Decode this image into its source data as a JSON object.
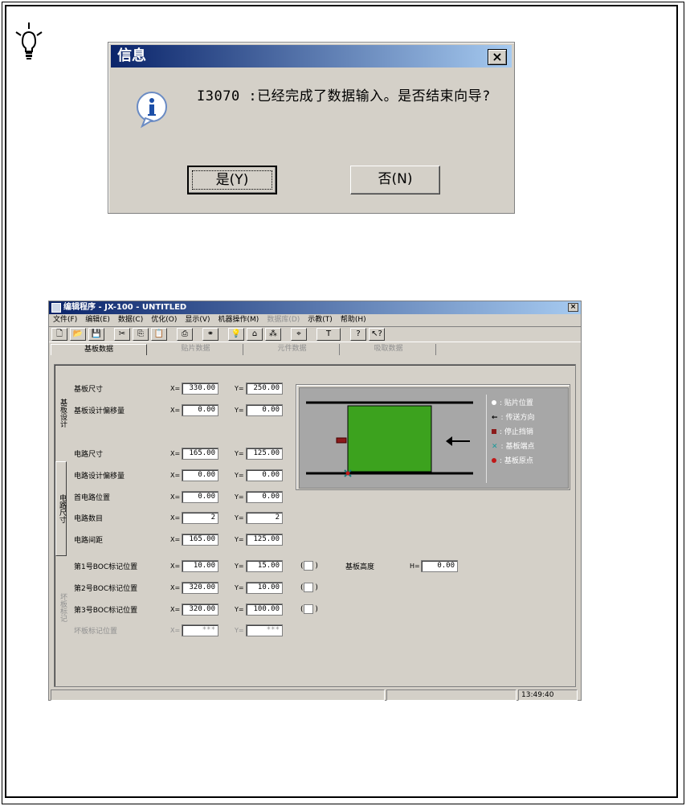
{
  "dialog": {
    "title": "信息",
    "close_glyph": "×",
    "message": "I3070 :已经完成了数据输入。是否结束向导?",
    "yes_label": "是(Y)",
    "no_label": "否(N)",
    "icon": "info-icon"
  },
  "app": {
    "title": "编辑程序 - JX-100 - UNTITLED",
    "close_glyph": "×",
    "menu": [
      {
        "label": "文件(F)",
        "enabled": true
      },
      {
        "label": "编辑(E)",
        "enabled": true
      },
      {
        "label": "数据(C)",
        "enabled": true
      },
      {
        "label": "优化(O)",
        "enabled": true
      },
      {
        "label": "显示(V)",
        "enabled": true
      },
      {
        "label": "机器操作(M)",
        "enabled": true
      },
      {
        "label": "数据库(D)",
        "enabled": false
      },
      {
        "label": "示教(T)",
        "enabled": true
      },
      {
        "label": "帮助(H)",
        "enabled": true
      }
    ],
    "toolbar": {
      "new": "🗋",
      "open": "📂",
      "save": "💾",
      "cut": "✂",
      "copy": "⎘",
      "paste": "📋",
      "print": "⎙",
      "find": "⚭",
      "hint": "💡",
      "machine": "⌂",
      "optimize": "⁂",
      "teach": "⌖",
      "text": "T",
      "help": "?",
      "context_help": "↖?"
    },
    "tabs": [
      "基板数据",
      "贴片数据",
      "元件数据",
      "吸取数据"
    ],
    "vtabs": [
      "基板设计",
      "电路尺寸",
      "坏板标记"
    ],
    "rows": {
      "board_size": {
        "label": "基板尺寸",
        "x": "330.00",
        "y": "250.00"
      },
      "board_offset": {
        "label": "基板设计偏移量",
        "x": "0.00",
        "y": "0.00"
      },
      "circuit_size": {
        "label": "电路尺寸",
        "x": "165.00",
        "y": "125.00"
      },
      "circuit_offset": {
        "label": "电路设计偏移量",
        "x": "0.00",
        "y": "0.00"
      },
      "first_circuit": {
        "label": "首电路位置",
        "x": "0.00",
        "y": "0.00"
      },
      "circuit_count": {
        "label": "电路数目",
        "x": "2",
        "y": "2"
      },
      "circuit_pitch": {
        "label": "电路间距",
        "x": "165.00",
        "y": "125.00"
      },
      "boc1": {
        "label": "第1号BOC标记位置",
        "x": "10.00",
        "y": "15.00"
      },
      "boc2": {
        "label": "第2号BOC标记位置",
        "x": "320.00",
        "y": "10.00"
      },
      "boc3": {
        "label": "第3号BOC标记位置",
        "x": "320.00",
        "y": "100.00"
      },
      "bad_mark": {
        "label": "坏板标记位置",
        "x": "***",
        "y": "***"
      }
    },
    "x_prefix": "X=",
    "y_prefix": "Y=",
    "h_prefix": "H=",
    "check_open": "(",
    "check_close": ")",
    "board_height": {
      "label": "基板高度",
      "value": "0.00"
    },
    "legend": [
      {
        "text": ": 贴片位置",
        "icon": "dot-icon"
      },
      {
        "text": ": 传送方向",
        "icon": "arrow-left-icon"
      },
      {
        "text": ": 停止挡销",
        "icon": "stopper-icon"
      },
      {
        "text": ": 基板端点",
        "icon": "cross-icon"
      },
      {
        "text": ": 基板原点",
        "icon": "origin-icon"
      }
    ],
    "status_time": "13:49:40"
  },
  "colors": {
    "title_start": "#0a246a",
    "title_end": "#a6caf0",
    "board_green": "#3ca21e",
    "stopper": "#8b1a1a",
    "face": "#d4d0c8"
  }
}
